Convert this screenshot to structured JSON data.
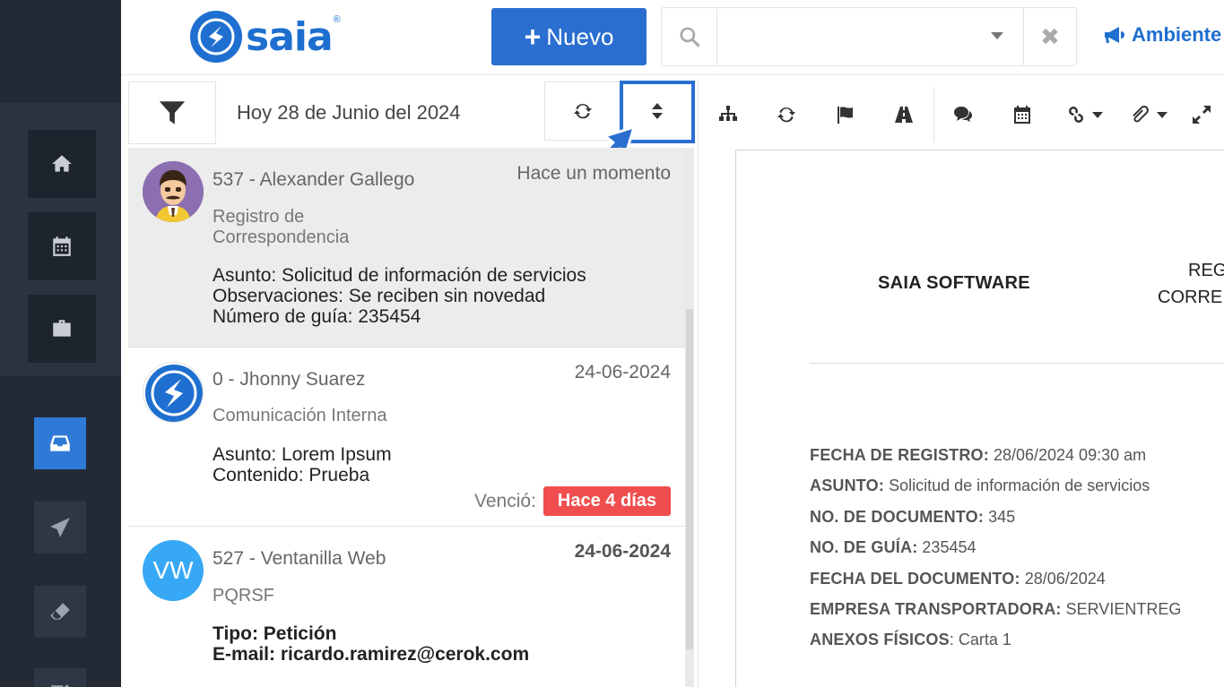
{
  "header": {
    "logo_text": "saia",
    "logo_reg": "®",
    "new_button_label": "Nuevo",
    "search_placeholder": "",
    "ambiente_label": "Ambiente"
  },
  "list_toolbar": {
    "date_label": "Hoy 28 de Junio del 2024"
  },
  "items": [
    {
      "title": "537 - Alexander Gallego",
      "time": "Hace un momento",
      "type_line1": "Registro de",
      "type_line2": "Correspondencia",
      "body1": "Asunto: Solicitud de información de servicios",
      "body2": "Observaciones: Se reciben sin novedad",
      "body3": "Número de guía: 235454"
    },
    {
      "title": "0 - Jhonny Suarez",
      "time": "24-06-2024",
      "type": "Comunicación Interna",
      "body1": "Asunto: Lorem Ipsum",
      "body2": "Contenido: Prueba",
      "expired_label": "Venció:",
      "expired_badge": "Hace 4 días"
    },
    {
      "avatar_initials": "VW",
      "title": "527 - Ventanilla Web",
      "time": "24-06-2024",
      "type": "PQRSF",
      "body1": "Tipo: Petición",
      "body2": "E-mail: ricardo.ramirez@cerok.com"
    }
  ],
  "document": {
    "company": "SAIA SOFTWARE",
    "title_line1": "REG",
    "title_line2": "CORRE",
    "fields": [
      {
        "label": "FECHA DE REGISTRO:",
        "value": "28/06/2024 09:30 am"
      },
      {
        "label": "ASUNTO:",
        "value": "Solicitud de información de servicios"
      },
      {
        "label": "NO. DE DOCUMENTO:",
        "value": "345"
      },
      {
        "label": "NO. DE GUÍA:",
        "value": "235454"
      },
      {
        "label": "FECHA DEL DOCUMENTO:",
        "value": "28/06/2024"
      },
      {
        "label": "EMPRESA TRANSPORTADORA:",
        "value": "SERVIENTREG"
      },
      {
        "label": "ANEXOS FÍSICOS",
        "value": ": Carta 1"
      }
    ]
  },
  "colors": {
    "brand": "#2a6fd0",
    "sidebar": "#232a36",
    "badge": "#f04e4e"
  }
}
